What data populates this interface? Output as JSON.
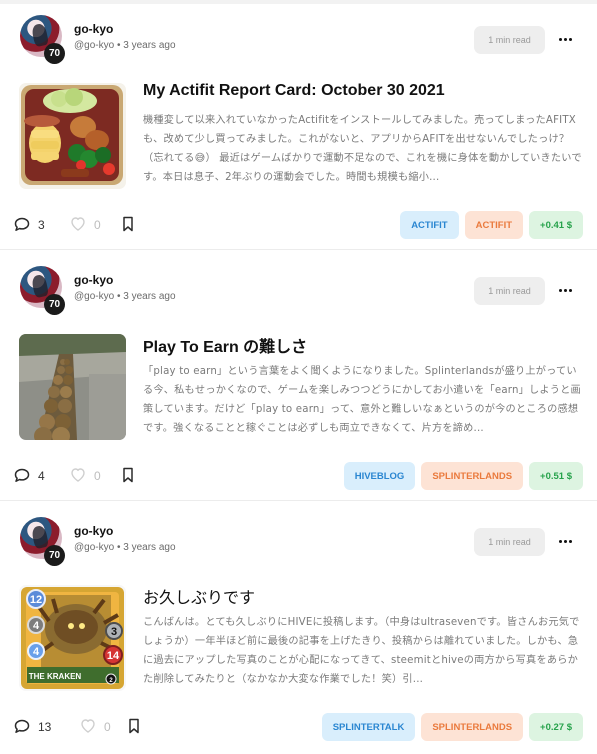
{
  "posts": [
    {
      "author": "go-kyo",
      "reputation": "70",
      "handle": "@go-kyo",
      "separator": "•",
      "age": "3 years ago",
      "read_time": "1 min read",
      "title": "My Actifit Report Card: October 30 2021",
      "excerpt": "機種変して以来入れていなかったActifitをインストールしてみました。売ってしまったAFITXも、改めて少し買ってみました。これがないと、アプリからAFITを出せないんでしたっけ？（忘れてる😅） 最近はゲームばかりで運動不足なので、これを機に身体を動かしていきたいです。本日は息子、2年ぶりの運動会でした。時間も規模も縮小...",
      "comments": "3",
      "votes": "0",
      "tags": [
        {
          "label": "ACTIFIT",
          "style": "blue"
        },
        {
          "label": "ACTIFIT",
          "style": "orange"
        },
        {
          "label": "+0.41 $",
          "style": "green"
        }
      ],
      "thumbnail": "bento-box-photo"
    },
    {
      "author": "go-kyo",
      "reputation": "70",
      "handle": "@go-kyo",
      "separator": "•",
      "age": "3 years ago",
      "read_time": "1 min read",
      "title": "Play To Earn の難しさ",
      "excerpt": "「play to earn」という言葉をよく聞くようになりました。Splinterlandsが盛り上がっている今、私もせっかくなので、ゲームを楽しみつつどうにかしてお小遣いを「earn」しようと画策しています。だけど「play to earn」って、意外と難しいなぁというのが今のところの感想です。強くなることと稼ぐことは必ずしも両立できなくて、片方を諦め...",
      "comments": "4",
      "votes": "0",
      "tags": [
        {
          "label": "HIVEBLOG",
          "style": "blue"
        },
        {
          "label": "SPLINTERLANDS",
          "style": "orange"
        },
        {
          "label": "+0.51 $",
          "style": "green"
        }
      ],
      "thumbnail": "kiwi-row-photo"
    },
    {
      "author": "go-kyo",
      "reputation": "70",
      "handle": "@go-kyo",
      "separator": "•",
      "age": "3 years ago",
      "read_time": "1 min read",
      "title": "お久しぶりです",
      "excerpt": "こんばんは。とても久しぶりにHIVEに投稿します。（中身はultrasevenです。皆さんお元気でしょうか）一年半ほど前に最後の記事を上げたきり、投稿からは離れていました。しかも、急に過去にアップした写真のことが心配になってきて、steemitとhiveの両方から写真をあらかた削除してみたりと（なかなか大変な作業でした！笑）引...",
      "comments": "13",
      "votes": "0",
      "tags": [
        {
          "label": "SPLINTERTALK",
          "style": "blue"
        },
        {
          "label": "SPLINTERLANDS",
          "style": "orange"
        },
        {
          "label": "+0.27 $",
          "style": "green"
        }
      ],
      "thumbnail": "kraken-card",
      "card": {
        "mana": "12",
        "attack": "3",
        "speed": "4",
        "armor": "4",
        "health": "14",
        "level": "2",
        "name": "THE KRAKEN"
      }
    }
  ]
}
